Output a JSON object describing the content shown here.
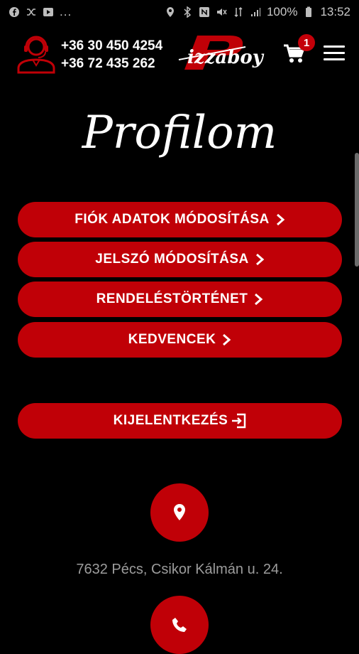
{
  "status": {
    "battery": "100%",
    "time": "13:52",
    "dots": "..."
  },
  "header": {
    "phone1": "+36 30 450 4254",
    "phone2": "+36 72 435 262",
    "logo_letter": "P",
    "logo_text": "izzaboy",
    "cart_count": "1"
  },
  "page": {
    "title": "Profilom"
  },
  "menu_buttons": [
    {
      "label": "FIÓK ADATOK MÓDOSÍTÁSA"
    },
    {
      "label": "JELSZÓ MÓDOSÍTÁSA"
    },
    {
      "label": "RENDELÉSTÖRTÉNET"
    },
    {
      "label": "KEDVENCEK"
    }
  ],
  "logout": {
    "label": "KIJELENTKEZÉS"
  },
  "contact": {
    "address": "7632 Pécs, Csikor Kálmán u. 24."
  },
  "colors": {
    "accent": "#c00007",
    "background": "#000000"
  },
  "icons": {
    "support": "headset-person-icon",
    "cart": "cart-icon",
    "menu": "hamburger-icon",
    "chevron": "chevron-right-icon",
    "logout": "logout-icon",
    "location": "location-pin-icon",
    "phone": "phone-icon"
  }
}
